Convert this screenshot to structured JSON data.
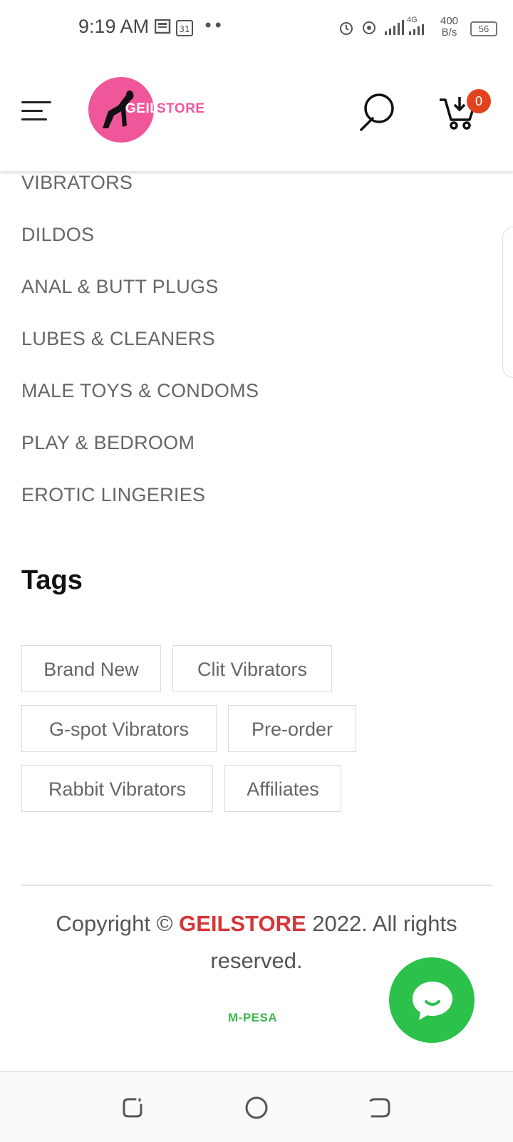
{
  "status_bar": {
    "time": "9:19 AM",
    "calendar_day": "31",
    "dots": "••",
    "network": "4G",
    "speed_value": "400",
    "speed_unit": "B/s",
    "battery": "56"
  },
  "header": {
    "logo_text_1": "GEIL",
    "logo_text_2": "STORE",
    "cart_count": "0",
    "logo_color": "#f0579a",
    "badge_color": "#e2431f"
  },
  "categories": [
    "VIBRATORS",
    "DILDOS",
    "ANAL & BUTT PLUGS",
    "LUBES & CLEANERS",
    "MALE TOYS & CONDOMS",
    "PLAY & BEDROOM",
    "EROTIC LINGERIES"
  ],
  "tags": {
    "title": "Tags",
    "items": [
      "Brand New",
      "Clit Vibrators",
      "G-spot Vibrators",
      "Pre-order",
      "Rabbit Vibrators",
      "Affiliates"
    ]
  },
  "footer": {
    "copyright_prefix": "Copyright © ",
    "brand": "GEILSTORE",
    "copyright_suffix": " 2022. All rights reserved.",
    "brand_color": "#d63638",
    "payment": "M-PESA",
    "chat_color": "#2bc14a"
  }
}
